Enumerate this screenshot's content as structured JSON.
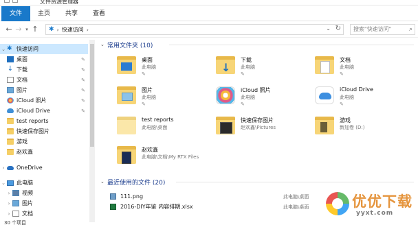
{
  "window": {
    "title": "文件资源管理器"
  },
  "ribbon": {
    "tabs": [
      "文件",
      "主页",
      "共享",
      "查看"
    ]
  },
  "address": {
    "star_icon": "quick-access-star-icon",
    "crumb": "快速访问",
    "separator": "›",
    "search_placeholder": "搜索\"快速访问\""
  },
  "nav": {
    "quick_access": "快速访问",
    "pinned": [
      {
        "label": "桌面",
        "icon": "desktop-icon"
      },
      {
        "label": "下载",
        "icon": "download-icon"
      },
      {
        "label": "文档",
        "icon": "document-icon"
      },
      {
        "label": "图片",
        "icon": "picture-icon"
      },
      {
        "label": "iCloud 照片",
        "icon": "icloud-photos-icon"
      },
      {
        "label": "iCloud Drive",
        "icon": "icloud-drive-icon"
      }
    ],
    "folders": [
      "test reports",
      "快速保存图片",
      "游戏",
      "赵欢鑫"
    ],
    "onedrive": "OneDrive",
    "this_pc": "此电脑",
    "pc_children": [
      "视频",
      "图片",
      "文档"
    ]
  },
  "content": {
    "frequent_header": "常用文件夹 (10)",
    "frequent": [
      {
        "name": "桌面",
        "location": "此电脑",
        "pinned": true
      },
      {
        "name": "下载",
        "location": "此电脑",
        "pinned": true
      },
      {
        "name": "文档",
        "location": "此电脑",
        "pinned": true
      },
      {
        "name": "图片",
        "location": "此电脑",
        "pinned": true
      },
      {
        "name": "iCloud 照片",
        "location": "此电脑",
        "pinned": true
      },
      {
        "name": "iCloud Drive",
        "location": "此电脑",
        "pinned": true
      },
      {
        "name": "test reports",
        "location": "此电脑\\桌面",
        "pinned": false
      },
      {
        "name": "快速保存图片",
        "location": "赵欢鑫\\Pictures",
        "pinned": false
      },
      {
        "name": "游戏",
        "location": "新加卷 (D:)",
        "pinned": false
      },
      {
        "name": "赵欢鑫",
        "location": "此电脑\\文档\\My RTX Files",
        "pinned": false
      }
    ],
    "recent_header": "最近使用的文件 (20)",
    "recent": [
      {
        "name": "111.png",
        "location": "此电脑\\桌面"
      },
      {
        "name": "2016-DIY年鉴 内容排期.xlsx",
        "location": "此电脑\\桌面"
      }
    ]
  },
  "status": {
    "items": "30 个项目"
  },
  "watermark": {
    "brand": "优优下载",
    "url": "yyxt.com"
  }
}
